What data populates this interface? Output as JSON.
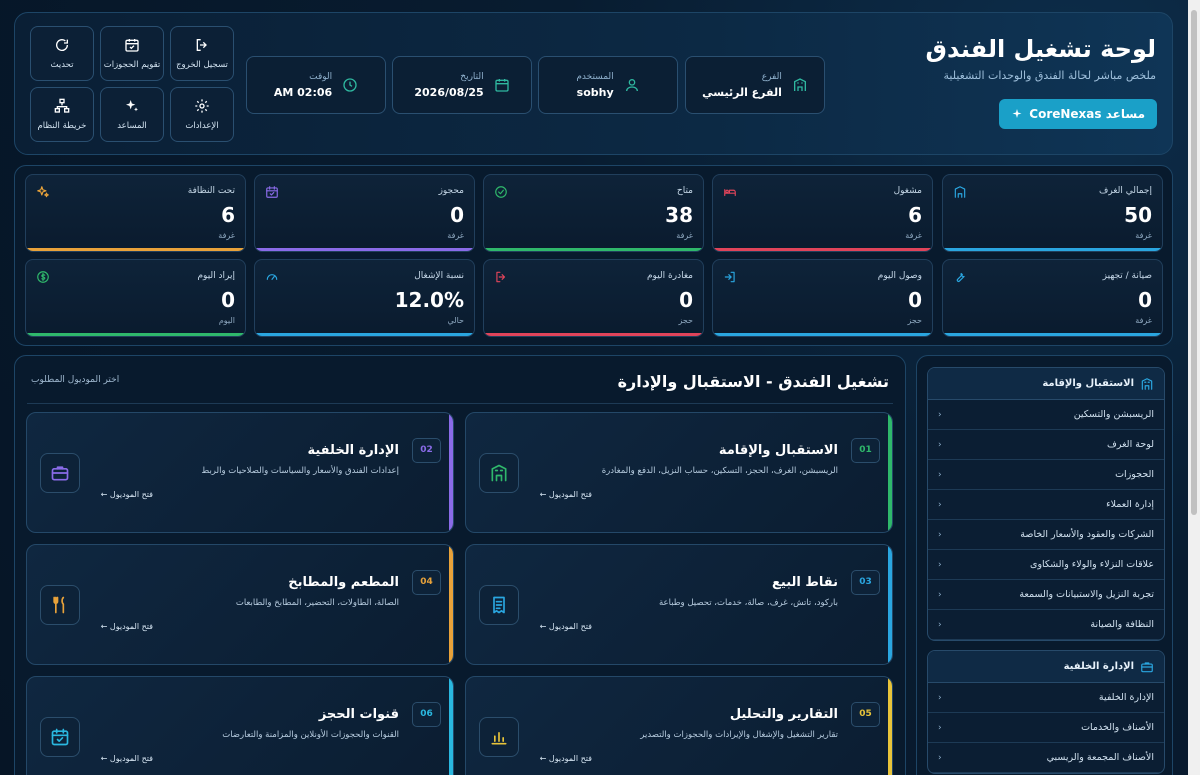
{
  "header": {
    "title": "لوحة تشغيل الفندق",
    "subtitle": "ملخص مباشر لحالة الفندق والوحدات التشغيلية",
    "assistant_button": "مساعد CoreNexas",
    "info": {
      "branch": {
        "label": "الفرع",
        "value": "الفرع الرئيسي"
      },
      "user": {
        "label": "المستخدم",
        "value": "sobhy"
      },
      "date": {
        "label": "التاريخ",
        "value": "2026/08/25"
      },
      "time": {
        "label": "الوقت",
        "value": "AM 02:06"
      }
    },
    "quick": {
      "logout": "تسجيل الخروج",
      "calendar": "تقويم الحجوزات",
      "refresh": "تحديث",
      "settings": "الإعدادات",
      "assistant": "المساعد",
      "system_map": "خريطة النظام"
    }
  },
  "stats": [
    {
      "label": "إجمالي الغرف",
      "value": "50",
      "unit": "غرفة",
      "icon": "building-icon",
      "color": "#2aa6e0"
    },
    {
      "label": "مشغول",
      "value": "6",
      "unit": "غرفة",
      "icon": "bed-icon",
      "color": "#e0445a"
    },
    {
      "label": "متاح",
      "value": "38",
      "unit": "غرفة",
      "icon": "check-circle-icon",
      "color": "#2fb86b"
    },
    {
      "label": "محجوز",
      "value": "0",
      "unit": "غرفة",
      "icon": "calendar-check-icon",
      "color": "#8a6be8"
    },
    {
      "label": "تحت النظافة",
      "value": "6",
      "unit": "غرفة",
      "icon": "sparkle-icon",
      "color": "#e8a23a"
    },
    {
      "label": "صيانة / تجهيز",
      "value": "0",
      "unit": "غرفة",
      "icon": "wrench-icon",
      "color": "#2aa6e0"
    },
    {
      "label": "وصول اليوم",
      "value": "0",
      "unit": "حجز",
      "icon": "login-icon",
      "color": "#2aa6e0"
    },
    {
      "label": "مغادرة اليوم",
      "value": "0",
      "unit": "حجز",
      "icon": "logout-icon",
      "color": "#e0445a"
    },
    {
      "label": "نسبة الإشغال",
      "value": "12.0%",
      "unit": "حالي",
      "icon": "gauge-icon",
      "color": "#2aa6e0"
    },
    {
      "label": "إيراد اليوم",
      "value": "0",
      "unit": "اليوم",
      "icon": "dollar-icon",
      "color": "#2fb86b"
    }
  ],
  "main": {
    "title": "تشغيل الفندق - الاستقبال والإدارة",
    "hint": "اختر الموديول المطلوب",
    "open_label": "فتح الموديول ←",
    "modules": [
      {
        "num": "01",
        "title": "الاستقبال والإقامة",
        "desc": "الريسبشن، الغرف، الحجز، التسكين، حساب النزيل، الدفع والمغادرة",
        "color": "#2fb86b",
        "icon": "hotel-icon"
      },
      {
        "num": "02",
        "title": "الإدارة الخلفية",
        "desc": "إعدادات الفندق والأسعار والسياسات والصلاحيات والربط",
        "color": "#8a6be8",
        "icon": "briefcase-icon"
      },
      {
        "num": "03",
        "title": "نقاط البيع",
        "desc": "باركود، تاتش، غرف، صالة، خدمات، تحصيل وطباعة",
        "color": "#2aa6e0",
        "icon": "receipt-icon"
      },
      {
        "num": "04",
        "title": "المطعم والمطابخ",
        "desc": "الصالة، الطاولات، التحضير، المطابخ والطابعات",
        "color": "#e8a23a",
        "icon": "utensils-icon"
      },
      {
        "num": "05",
        "title": "التقارير والتحليل",
        "desc": "تقارير التشغيل والإشغال والإيرادات والحجوزات والتصدير",
        "color": "#e8c43a",
        "icon": "chart-icon"
      },
      {
        "num": "06",
        "title": "قنوات الحجز",
        "desc": "القنوات والحجوزات الأونلاين والمزامنة والتعارضات",
        "color": "#2ab8e0",
        "icon": "calendar-icon"
      }
    ]
  },
  "side": {
    "groups": [
      {
        "title": "الاستقبال والإقامة",
        "icon": "hotel-icon",
        "items": [
          "الريسبشن والتسكين",
          "لوحة الغرف",
          "الحجوزات",
          "إدارة العملاء",
          "الشركات والعقود والأسعار الخاصة",
          "علاقات النزلاء والولاء والشكاوى",
          "تجربة النزيل والاستبيانات والسمعة",
          "النظافة والصيانة"
        ]
      },
      {
        "title": "الإدارة الخلفية",
        "icon": "briefcase-icon",
        "items": [
          "الإدارة الخلفية",
          "الأصناف والخدمات",
          "الأصناف المجمعة والريسبي"
        ]
      }
    ]
  }
}
